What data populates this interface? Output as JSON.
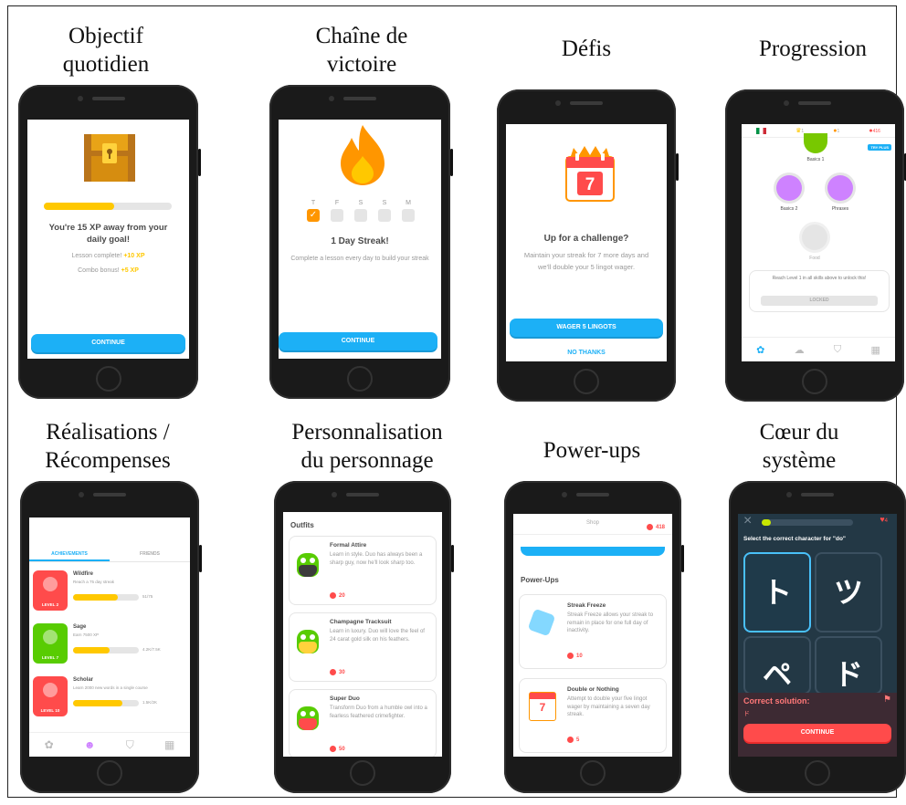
{
  "captions": {
    "daily": "Objectif\nquotidien",
    "streak": "Chaîne de\nvictoire",
    "challenges": "Défis",
    "progression": "Progression",
    "achievements": "Réalisations /\nRécompenses",
    "custom": "Personnalisation\ndu personnage",
    "powerups": "Power-ups",
    "core": "Cœur du\nsystème"
  },
  "s1": {
    "headline": "You're 15 XP away from your daily goal!",
    "lesson_label": "Lesson complete!",
    "lesson_xp": "+10 XP",
    "combo_label": "Combo bonus!",
    "combo_xp": "+5 XP",
    "button": "CONTINUE",
    "progress": 0.55
  },
  "s2": {
    "days": [
      "T",
      "F",
      "S",
      "S",
      "M"
    ],
    "headline": "1 Day Streak!",
    "text": "Complete a lesson every day to build your streak",
    "button": "CONTINUE"
  },
  "s3": {
    "calendar_day": "7",
    "headline": "Up for a challenge?",
    "text": "Maintain your streak for 7 more days and we'll double your 5 lingot wager.",
    "button": "WAGER 5 LINGOTS",
    "secondary": "NO THANKS"
  },
  "s4": {
    "top_counts": [
      "1",
      "1",
      "416"
    ],
    "tag": "TRY PLUS",
    "skill1": "Basics 1",
    "skill2": "Basics 2",
    "skill3": "Phrases",
    "skill4": "Food",
    "lock_text": "Reach Level 1 in all skills above to unlock this!",
    "lock_button": "LOCKED"
  },
  "s5": {
    "tabs": [
      "ACHIEVEMENTS",
      "FRIENDS"
    ],
    "items": [
      {
        "title": "Wildfire",
        "desc": "Reach a 75 day streak",
        "level": "LEVEL 2",
        "value": "51/75",
        "color": "#ff4b4b",
        "fill": 0.68
      },
      {
        "title": "Sage",
        "desc": "Earn 7500 XP",
        "level": "LEVEL 7",
        "value": "4.2K/7.5K",
        "color": "#58cc02",
        "fill": 0.56
      },
      {
        "title": "Scholar",
        "desc": "Learn 2000 new words in a single course",
        "level": "LEVEL 10",
        "value": "1.5K/2K",
        "color": "#ff4b4b",
        "fill": 0.75
      }
    ]
  },
  "s6": {
    "heading": "Outfits",
    "items": [
      {
        "title": "Formal Attire",
        "desc": "Learn in style. Duo has always been a sharp guy, now he'll look sharp too.",
        "price": "20"
      },
      {
        "title": "Champagne Tracksuit",
        "desc": "Learn in luxury. Duo will love the feel of 24 carat gold silk on his feathers.",
        "price": "30"
      },
      {
        "title": "Super Duo",
        "desc": "Transform Duo from a humble owl into a fearless feathered crimefighter.",
        "price": "50"
      }
    ]
  },
  "s7": {
    "header": "Shop",
    "gems": "418",
    "heading": "Power-Ups",
    "items": [
      {
        "title": "Streak Freeze",
        "desc": "Streak Freeze allows your streak to remain in place for one full day of inactivity.",
        "price": "10"
      },
      {
        "title": "Double or Nothing",
        "desc": "Attempt to double your five lingot wager by maintaining a seven day streak.",
        "price": "5"
      }
    ]
  },
  "s8": {
    "close": "×",
    "hearts": "4",
    "prompt": "Select the correct character for \"do\"",
    "chars": [
      "ト",
      "ツ",
      "ペ",
      "ド"
    ],
    "solution_label": "Correct solution:",
    "solution": "ド",
    "button": "CONTINUE",
    "progress": 0.1
  }
}
